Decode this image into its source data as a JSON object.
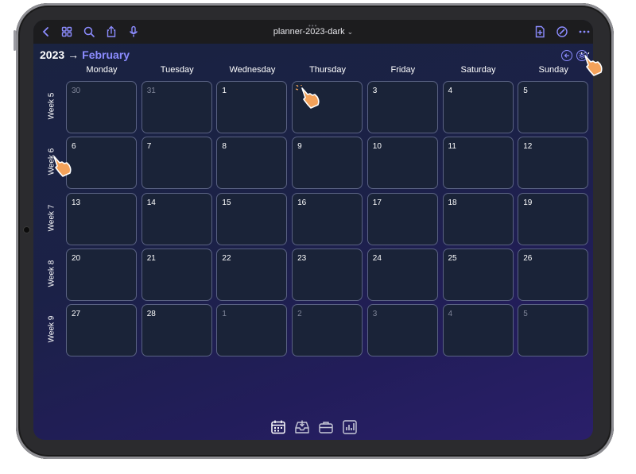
{
  "toolbar": {
    "doc_title": "planner-2023-dark",
    "title_chevron": "⌄",
    "grabber": "•••",
    "left_icons": [
      "back-chevron-icon",
      "grid-icon",
      "search-icon",
      "share-icon",
      "microphone-icon"
    ],
    "right_icons": [
      "add-page-icon",
      "pen-icon",
      "more-icon"
    ]
  },
  "breadcrumb": {
    "year": "2023",
    "arrow": "→",
    "month": "February"
  },
  "header_buttons": [
    "back-arrow-circle-icon",
    "settings-icon"
  ],
  "days": [
    "Monday",
    "Tuesday",
    "Wednesday",
    "Thursday",
    "Friday",
    "Saturday",
    "Sunday"
  ],
  "weeks": [
    {
      "label": "Week 5",
      "cells": [
        {
          "d": "30",
          "dim": true
        },
        {
          "d": "31",
          "dim": true
        },
        {
          "d": "1"
        },
        {
          "d": ""
        },
        {
          "d": "3"
        },
        {
          "d": "4"
        },
        {
          "d": "5"
        }
      ]
    },
    {
      "label": "Week 6",
      "cells": [
        {
          "d": "6"
        },
        {
          "d": "7"
        },
        {
          "d": "8"
        },
        {
          "d": "9"
        },
        {
          "d": "10"
        },
        {
          "d": "11"
        },
        {
          "d": "12"
        }
      ]
    },
    {
      "label": "Week 7",
      "cells": [
        {
          "d": "13"
        },
        {
          "d": "14"
        },
        {
          "d": "15"
        },
        {
          "d": "16"
        },
        {
          "d": "17"
        },
        {
          "d": "18"
        },
        {
          "d": "19"
        }
      ]
    },
    {
      "label": "Week 8",
      "cells": [
        {
          "d": "20"
        },
        {
          "d": "21"
        },
        {
          "d": "22"
        },
        {
          "d": "23"
        },
        {
          "d": "24"
        },
        {
          "d": "25"
        },
        {
          "d": "26"
        }
      ]
    },
    {
      "label": "Week 9",
      "cells": [
        {
          "d": "27"
        },
        {
          "d": "28"
        },
        {
          "d": "1",
          "dim": true
        },
        {
          "d": "2",
          "dim": true
        },
        {
          "d": "3",
          "dim": true
        },
        {
          "d": "4",
          "dim": true
        },
        {
          "d": "5",
          "dim": true
        }
      ]
    }
  ],
  "dock": [
    "calendar-icon",
    "inbox-icon",
    "briefcase-icon",
    "chart-icon"
  ],
  "colors": {
    "accent": "#8c8cff",
    "cell_border": "#5a6283",
    "cell_fill": "#1a2338",
    "hand": "#f4a25a"
  }
}
